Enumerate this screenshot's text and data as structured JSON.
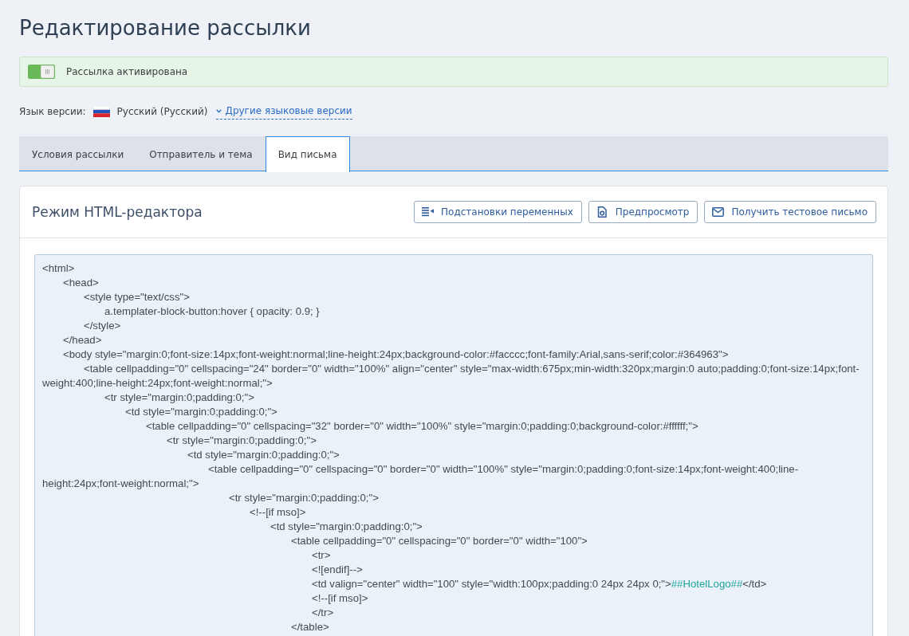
{
  "page": {
    "title": "Редактирование рассылки"
  },
  "activation": {
    "on": true,
    "label": "Рассылка активирована"
  },
  "language": {
    "label": "Язык версии:",
    "current": "Русский (Русский)",
    "other_versions_link": "Другие языковые версии"
  },
  "tabs": [
    {
      "label": "Условия рассылки",
      "selected": false
    },
    {
      "label": "Отправитель и тема",
      "selected": false
    },
    {
      "label": "Вид письма",
      "selected": true
    }
  ],
  "editor": {
    "title": "Режим HTML-редактора",
    "buttons": [
      {
        "kind": "variables",
        "label": "Подстановки переменных"
      },
      {
        "kind": "preview",
        "label": "Предпросмотр"
      },
      {
        "kind": "test_email",
        "label": "Получить тестовое письмо"
      }
    ],
    "lines": [
      [
        {
          "kind": "markup",
          "text": "<html>"
        }
      ],
      [
        {
          "kind": "markup",
          "text": "\t<head>"
        }
      ],
      [
        {
          "kind": "markup",
          "text": "\t\t<style type=\"text/css\">"
        }
      ],
      [
        {
          "kind": "markup",
          "text": "\t\t\ta.templater-block-button:hover { opacity: 0.9; }"
        }
      ],
      [
        {
          "kind": "markup",
          "text": "\t\t</style>"
        }
      ],
      [
        {
          "kind": "markup",
          "text": "\t</head>"
        }
      ],
      [
        {
          "kind": "markup",
          "text": "\t<body style=\"margin:0;font-size:14px;font-weight:normal;line-height:24px;background-color:#facccc;font-family:Arial,sans-serif;color:#364963\">"
        }
      ],
      [
        {
          "kind": "markup",
          "text": "\t\t<table cellpadding=\"0\" cellspacing=\"24\" border=\"0\" width=\"100%\" align=\"center\" style=\"max-width:675px;min-width:320px;margin:0 auto;padding:0;font-size:14px;font-weight:400;line-height:24px;font-weight:normal;\">"
        }
      ],
      [
        {
          "kind": "markup",
          "text": "\t\t\t<tr style=\"margin:0;padding:0;\">"
        }
      ],
      [
        {
          "kind": "markup",
          "text": "\t\t\t\t<td style=\"margin:0;padding:0;\">"
        }
      ],
      [
        {
          "kind": "markup",
          "text": "\t\t\t\t\t<table cellpadding=\"0\" cellspacing=\"32\" border=\"0\" width=\"100%\" style=\"margin:0;padding:0;background-color:#ffffff;\">"
        }
      ],
      [
        {
          "kind": "markup",
          "text": "\t\t\t\t\t\t<tr style=\"margin:0;padding:0;\">"
        }
      ],
      [
        {
          "kind": "markup",
          "text": "\t\t\t\t\t\t\t<td style=\"margin:0;padding:0;\">"
        }
      ],
      [
        {
          "kind": "markup",
          "text": "\t\t\t\t\t\t\t\t<table cellpadding=\"0\" cellspacing=\"0\" border=\"0\" width=\"100%\" style=\"margin:0;padding:0;font-size:14px;font-weight:400;line-height:24px;font-weight:normal;\">"
        }
      ],
      [
        {
          "kind": "markup",
          "text": "\t\t\t\t\t\t\t\t\t<tr style=\"margin:0;padding:0;\">"
        }
      ],
      [
        {
          "kind": "markup",
          "text": "\t\t\t\t\t\t\t\t\t\t<!--[if mso]>"
        }
      ],
      [
        {
          "kind": "markup",
          "text": "\t\t\t\t\t\t\t\t\t\t\t<td style=\"margin:0;padding:0;\">"
        }
      ],
      [
        {
          "kind": "markup",
          "text": "\t\t\t\t\t\t\t\t\t\t\t\t<table cellpadding=\"0\" cellspacing=\"0\" border=\"0\" width=\"100\">"
        }
      ],
      [
        {
          "kind": "markup",
          "text": "\t\t\t\t\t\t\t\t\t\t\t\t\t<tr>"
        }
      ],
      [
        {
          "kind": "markup",
          "text": "\t\t\t\t\t\t\t\t\t\t\t\t\t<![endif]-->"
        }
      ],
      [
        {
          "kind": "markup",
          "text": "\t\t\t\t\t\t\t\t\t\t\t\t\t<td valign=\"center\" width=\"100\" style=\"width:100px;padding:0 24px 24px 0;\">"
        },
        {
          "kind": "variable",
          "text": "##HotelLogo##"
        },
        {
          "kind": "markup",
          "text": "</td>"
        }
      ],
      [
        {
          "kind": "markup",
          "text": "\t\t\t\t\t\t\t\t\t\t\t\t\t<!--[if mso]>"
        }
      ],
      [
        {
          "kind": "markup",
          "text": "\t\t\t\t\t\t\t\t\t\t\t\t\t</tr>"
        }
      ],
      [
        {
          "kind": "markup",
          "text": "\t\t\t\t\t\t\t\t\t\t\t\t</table>"
        }
      ]
    ]
  }
}
